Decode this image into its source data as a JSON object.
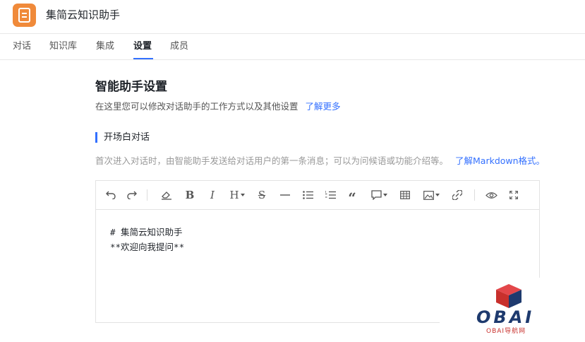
{
  "app": {
    "title": "集简云知识助手",
    "icon": "document-icon",
    "icon_color": "#f08a3a"
  },
  "tabs": [
    {
      "label": "对话",
      "active": false
    },
    {
      "label": "知识库",
      "active": false
    },
    {
      "label": "集成",
      "active": false
    },
    {
      "label": "设置",
      "active": true
    },
    {
      "label": "成员",
      "active": false
    }
  ],
  "settings": {
    "title": "智能助手设置",
    "description": "在这里您可以修改对话助手的工作方式以及其他设置",
    "learn_more": "了解更多"
  },
  "opening": {
    "title": "开场白对话",
    "description": "首次进入对话时，由智能助手发送给对话用户的第一条消息；可以为问候语或功能介绍等。",
    "markdown_link": "了解Markdown格式。"
  },
  "toolbar": {
    "undo": "undo-icon",
    "redo": "redo-icon",
    "clear": "eraser-icon",
    "bold": "B",
    "italic": "I",
    "heading": "H",
    "strike": "S",
    "hr": "horizontal-rule-icon",
    "ul": "bullet-list-icon",
    "ol": "ordered-list-icon",
    "quote": "“",
    "comment": "comment-icon",
    "table": "table-icon",
    "image": "image-icon",
    "link": "link-icon",
    "preview": "eye-icon",
    "fullscreen": "fullscreen-icon"
  },
  "editor": {
    "line1": "# 集简云知识助手",
    "line2": "**欢迎向我提问**"
  },
  "watermark": {
    "logo_text": "OBAI",
    "sub_text": "OBAI导航网"
  },
  "colors": {
    "accent": "#3370ff",
    "text": "#1f2329",
    "muted": "#999999"
  }
}
